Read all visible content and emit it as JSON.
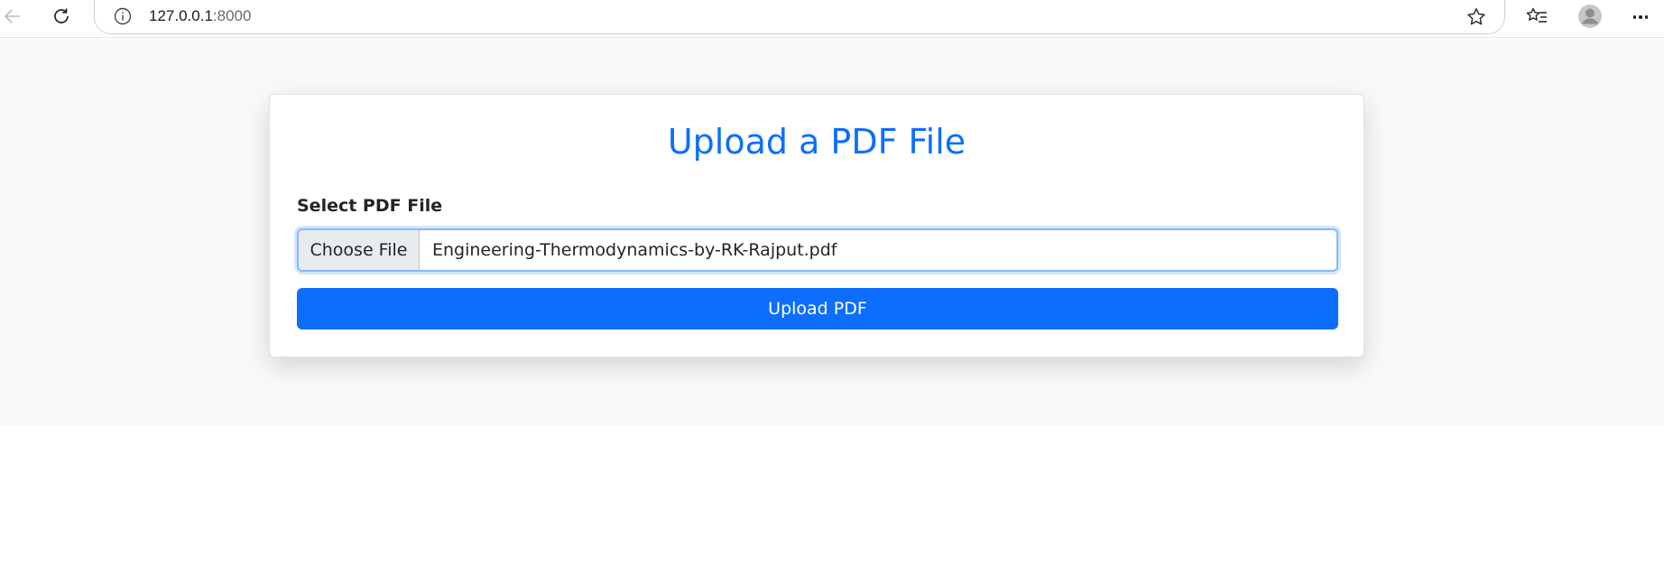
{
  "browser": {
    "url_host": "127.0.0.1",
    "url_port": ":8000",
    "icons": {
      "back": "arrow-left-icon",
      "reload": "reload-icon",
      "info": "info-icon",
      "star": "star-icon",
      "favorites": "favorites-icon",
      "profile": "profile-icon",
      "more": "more-icon"
    }
  },
  "card": {
    "title": "Upload a PDF File",
    "field_label": "Select PDF File",
    "choose_button": "Choose File",
    "file_name": "Engineering-Thermodynamics-by-RK-Rajput.pdf",
    "upload_button": "Upload PDF"
  },
  "colors": {
    "primary": "#0d6efd",
    "page_background": "#f8f9fa"
  }
}
